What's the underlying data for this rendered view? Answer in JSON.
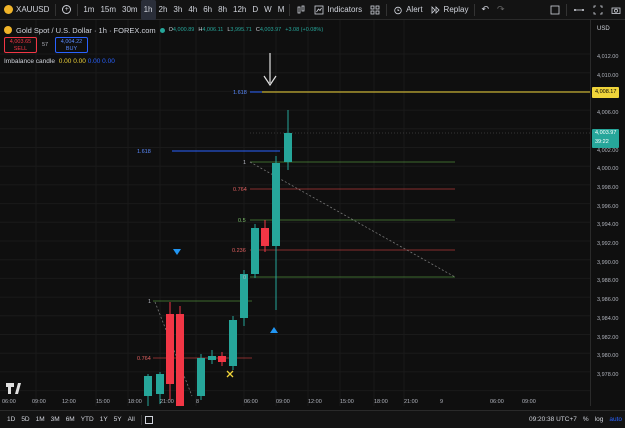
{
  "topbar": {
    "symbol": "XAUUSD",
    "timeframes": [
      "1m",
      "15m",
      "30m",
      "1h",
      "2h",
      "3h",
      "4h",
      "6h",
      "8h",
      "12h",
      "D",
      "W",
      "M"
    ],
    "active_timeframe": "1h",
    "indicators_label": "Indicators",
    "alert_label": "Alert",
    "replay_label": "Replay",
    "currency": "USD"
  },
  "legend": {
    "title": "Gold Spot / U.S. Dollar · 1h · FOREX.com",
    "open_label": "O",
    "open": "4,000.89",
    "high_label": "H",
    "high": "4,006.11",
    "low_label": "L",
    "low": "3,995.71",
    "close_label": "C",
    "close": "4,003.97",
    "change": "+3.08 (+0.08%)",
    "sell_price": "4,003.65",
    "sell_label": "SELL",
    "spread": "57",
    "buy_price": "4,004.22",
    "buy_label": "BUY",
    "imbalance_label": "Imbalance candle",
    "imbalance_values": [
      "0.00",
      "0.00",
      "0.00",
      "0.00"
    ]
  },
  "colors": {
    "up": "#26a69a",
    "down": "#f23645",
    "yellow": "#f0d43a",
    "blue": "#2962ff",
    "bg": "#0f0f0f"
  },
  "price_axis": {
    "labels": [
      "4,012.00",
      "4,010.00",
      "4,008.00",
      "4,006.00",
      "4,002.00",
      "4,000.00",
      "3,998.00",
      "3,996.00",
      "3,994.00",
      "3,992.00",
      "3,990.00",
      "3,988.00",
      "3,986.00",
      "3,984.00",
      "3,982.00",
      "3,980.00",
      "3,978.00"
    ],
    "ticks": [
      4012,
      4010,
      4008,
      4006,
      4002,
      4000,
      3998,
      3996,
      3994,
      3992,
      3990,
      3988,
      3986,
      3984,
      3982,
      3980,
      3978
    ],
    "yellow_tag": "4,008.17",
    "current_tag": "4,003.97",
    "countdown": "39:22"
  },
  "time_axis": {
    "labels": [
      "06:00",
      "09:00",
      "12:00",
      "15:00",
      "18:00",
      "21:00",
      "8",
      "06:00",
      "09:00",
      "12:00",
      "15:00",
      "18:00",
      "21:00",
      "9",
      "06:00",
      "09:00"
    ]
  },
  "fib_labels": {
    "top_blue": "1.618",
    "mid_blue": "1.618",
    "one_a": "1",
    "r0764": "0.764",
    "r05": "0.5",
    "r0236": "0.236",
    "zero": "0",
    "one_b": "1",
    "lower_0764": "0.764"
  },
  "bottombar": {
    "ranges": [
      "1D",
      "5D",
      "1M",
      "3M",
      "6M",
      "YTD",
      "1Y",
      "5Y",
      "All"
    ],
    "clock": "09:20:38 UTC+7"
  }
}
